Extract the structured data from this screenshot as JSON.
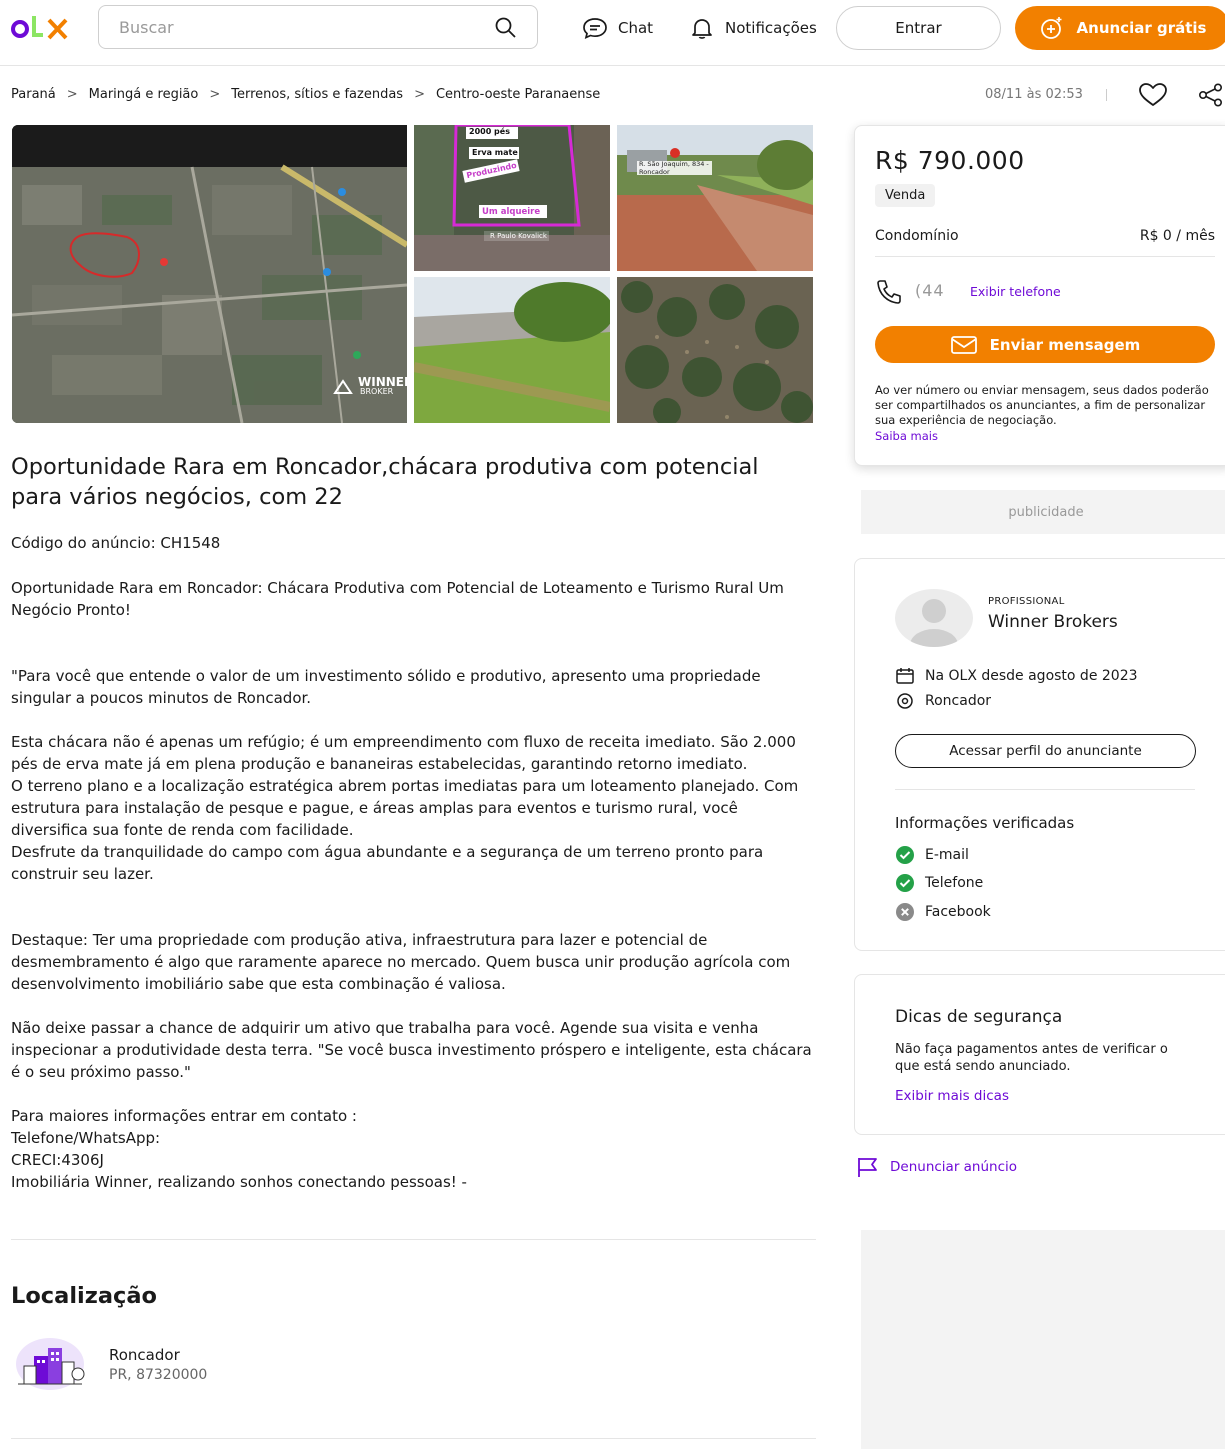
{
  "header": {
    "brand": "OLX",
    "search_placeholder": "Buscar",
    "chat_label": "Chat",
    "notifications_label": "Notificações",
    "login_label": "Entrar",
    "post_ad_label": "Anunciar grátis"
  },
  "breadcrumb": [
    "Paraná",
    "Maringá e região",
    "Terrenos, sítios e fazendas",
    "Centro-oeste Paranaense"
  ],
  "posted_at": "08/11 às 02:53",
  "gallery": {
    "watermark_main": "WINNER",
    "watermark_sub": "BROKER",
    "thumb1_labels": [
      "2000 pés",
      "Erva mate",
      "Produzindo",
      "Um alqueire",
      "R Paulo Kovalick"
    ],
    "thumb2_label": "R. São Joaquim, 834 - Roncador"
  },
  "listing": {
    "title": "Oportunidade Rara em Roncador,chácara produtiva com potencial para vários negócios, com 22",
    "code": "Código do anúncio: CH1548",
    "paragraphs": [
      "Oportunidade Rara em Roncador: Chácara Produtiva com Potencial de Loteamento e Turismo Rural  Um Negócio Pronto!",
      "\"Para você que entende o valor de um investimento sólido e produtivo, apresento uma propriedade singular a poucos minutos de Roncador.",
      "Esta chácara não é apenas um refúgio; é um empreendimento com fluxo de receita imediato. São 2.000 pés de erva mate já em plena produção e bananeiras estabelecidas, garantindo retorno imediato.\nO terreno plano e a localização estratégica abrem portas imediatas para um loteamento planejado. Com estrutura para instalação  de pesque e pague, e áreas amplas para eventos e turismo rural, você diversifica sua fonte de renda com facilidade.\nDesfrute da tranquilidade do campo com água abundante e a segurança de um terreno pronto para construir seu lazer.",
      "Destaque: Ter uma propriedade com produção ativa, infraestrutura para lazer e potencial de desmembramento é algo que raramente aparece no mercado. Quem busca unir produção agrícola com desenvolvimento imobiliário sabe que esta combinação é valiosa.",
      "Não deixe passar a chance de adquirir um ativo que trabalha para você. Agende sua visita e venha inspecionar a produtividade desta terra. \"Se você busca investimento próspero e inteligente, esta chácara é o seu próximo passo.\"",
      "Para maiores informações entrar em contato :\nTelefone/WhatsApp:\nCRECI:4306J\nImobiliária Winner, realizando sonhos conectando pessoas! -"
    ]
  },
  "location": {
    "heading": "Localização",
    "city": "Roncador",
    "cep": "PR, 87320000"
  },
  "price_card": {
    "price": "R$ 790.000",
    "type_badge": "Venda",
    "condo_label": "Condomínio",
    "condo_value": "R$ 0 / mês",
    "phone_partial": "(44",
    "show_phone": "Exibir telefone",
    "send_message": "Enviar mensagem",
    "disclaimer": "Ao ver número ou enviar mensagem, seus dados poderão ser compartilhados os anunciantes, a fim de personalizar sua experiência de negociação.",
    "learn_more": "Saiba mais"
  },
  "ad_label": "publicidade",
  "seller": {
    "tag": "PROFISSIONAL",
    "name": "Winner Brokers",
    "since": "Na OLX desde agosto de 2023",
    "city": "Roncador",
    "profile_button": "Acessar perfil do anunciante",
    "verified_title": "Informações verificadas",
    "verified": [
      {
        "label": "E-mail",
        "status": "verified"
      },
      {
        "label": "Telefone",
        "status": "verified"
      },
      {
        "label": "Facebook",
        "status": "not-verified"
      }
    ]
  },
  "tips": {
    "title": "Dicas de segurança",
    "text": "Não faça pagamentos antes de verificar o que está sendo anunciado.",
    "link": "Exibir mais dicas"
  },
  "report_label": "Denunciar anúncio",
  "colors": {
    "accent_orange": "#f28000",
    "accent_purple": "#6e0ad6",
    "verified_green": "#24a148"
  }
}
